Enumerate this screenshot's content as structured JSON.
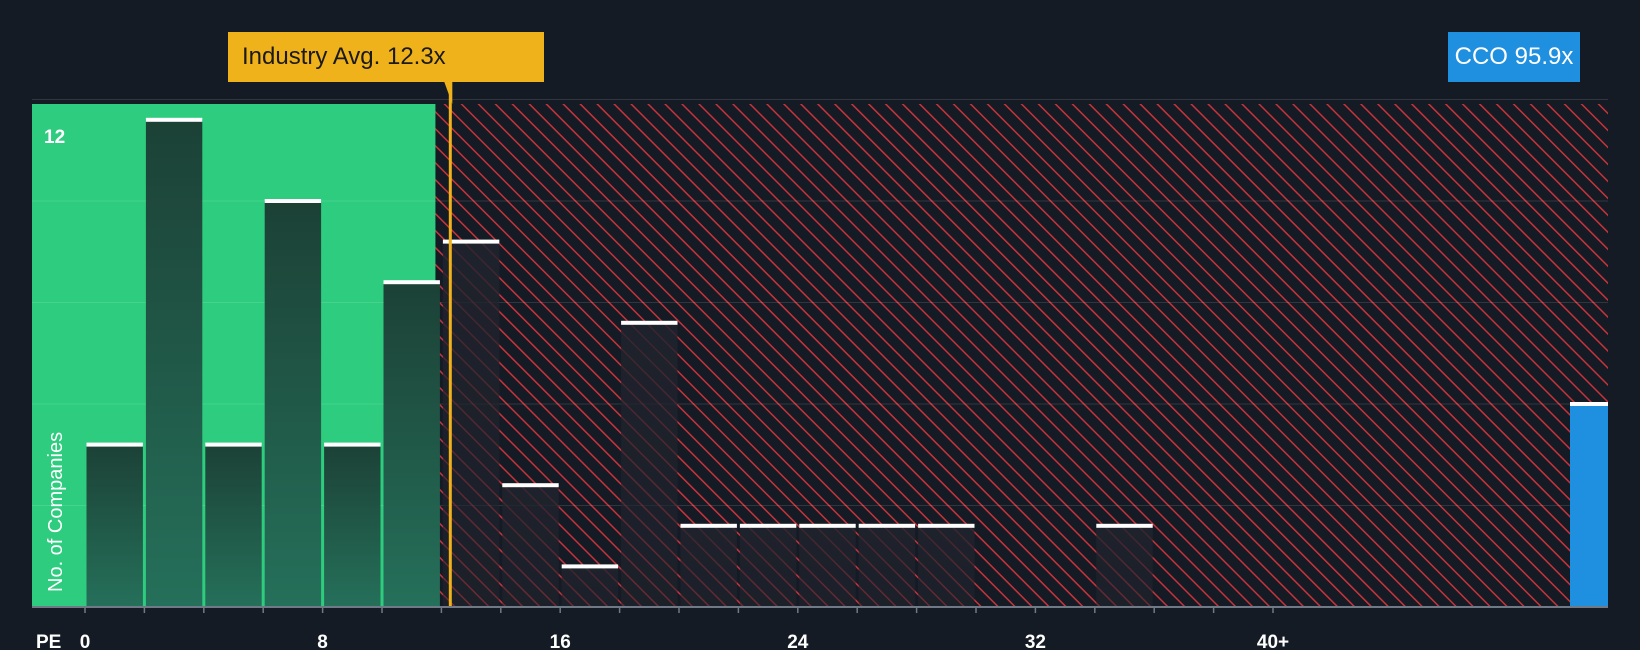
{
  "chart_data": {
    "type": "bar",
    "xlabel": "PE",
    "ylabel": "No. of Companies",
    "x_ticks": [
      "0",
      "8",
      "16",
      "24",
      "32",
      "40+"
    ],
    "y_ticks": [
      "12"
    ],
    "ylim": [
      0,
      12.5
    ],
    "bin_width": 2,
    "bins_start": [
      0,
      2,
      4,
      6,
      8,
      10,
      12,
      14,
      16,
      18,
      20,
      22,
      24,
      26,
      28,
      30,
      32,
      34,
      36,
      38
    ],
    "values": [
      4,
      12,
      4,
      10,
      4,
      8,
      9,
      3,
      1,
      7,
      2,
      2,
      2,
      2,
      2,
      0,
      0,
      2,
      0,
      0
    ],
    "overflow_value": 5,
    "industry_avg": {
      "label": "Industry Avg. 12.3x",
      "value": 12.3
    },
    "company": {
      "label": "CCO 95.9x",
      "value": 95.9
    },
    "fair_range_max": 11.8,
    "colors": {
      "background": "#151b24",
      "fair_zone": "#2ecc7e",
      "expensive_stripe": "#c8333b",
      "bar_dark": "#1e4a3c",
      "company_bar": "#1f8fe0",
      "industry": "#f0b21a"
    }
  }
}
